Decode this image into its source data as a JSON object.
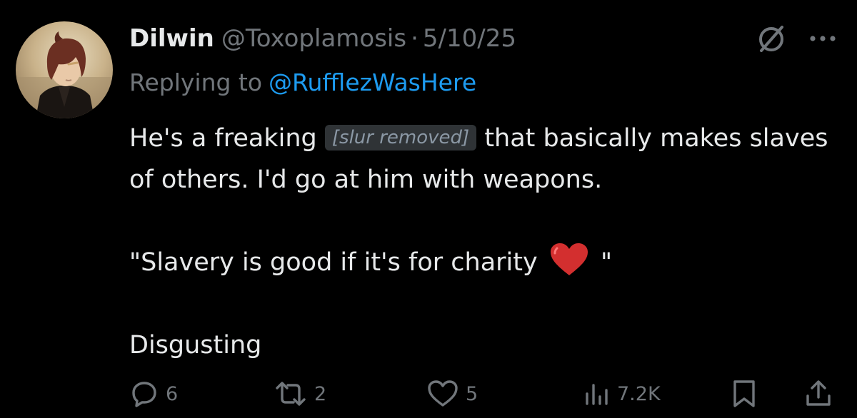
{
  "tweet": {
    "author": {
      "display_name": "Dilwin",
      "handle": "@Toxoplamosis",
      "separator": "·",
      "date": "5/10/25"
    },
    "reply": {
      "prefix": "Replying to",
      "handle": "@RufflezWasHere"
    },
    "body": {
      "line1_before": "He's a freaking",
      "line1_redacted": "[slur removed]",
      "line1_after": "that basically makes slaves of others. I'd go at him with weapons.",
      "quote_before": "\"Slavery is good if it's for charity",
      "quote_after": "\"",
      "closing": "Disgusting"
    },
    "header_icons": {
      "grok": "slashed-circle-icon",
      "more": "more-options-icon"
    },
    "actions": {
      "reply_count": "6",
      "retweet_count": "2",
      "like_count": "5",
      "views_count": "7.2K"
    },
    "colors": {
      "background": "#000000",
      "text": "#e7e9ea",
      "muted": "#71767b",
      "link": "#1d9bf0",
      "heart": "#d32f2f"
    }
  }
}
